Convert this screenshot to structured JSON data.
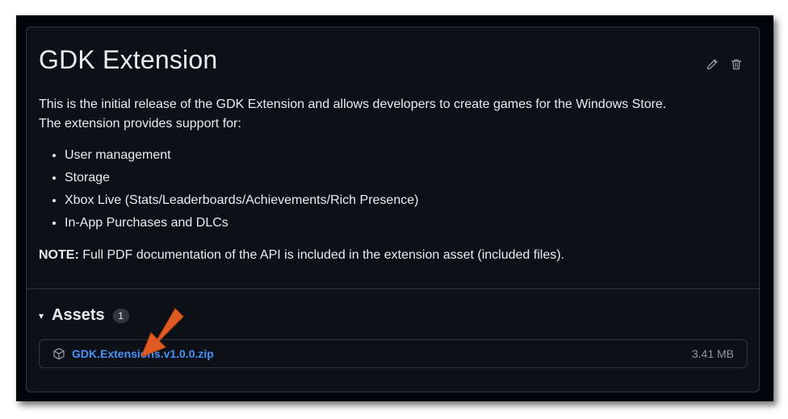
{
  "release": {
    "title": "GDK Extension",
    "description_line1": "This is the initial release of the GDK Extension and allows developers to create games for the Windows Store.",
    "description_line2": "The extension provides support for:",
    "features": [
      "User management",
      "Storage",
      "Xbox Live (Stats/Leaderboards/Achievements/Rich Presence)",
      "In-App Purchases and DLCs"
    ],
    "note_label": "NOTE:",
    "note_text": " Full PDF documentation of the API is included in the extension asset (included files).",
    "actions": {
      "edit_icon": "pencil-icon",
      "delete_icon": "trash-icon"
    }
  },
  "assets": {
    "caret": "▾",
    "label": "Assets",
    "count": "1",
    "items": [
      {
        "icon": "package-icon",
        "name": "GDK.Extensions.v1.0.0.zip",
        "size": "3.41 MB"
      }
    ]
  },
  "colors": {
    "background": "#0d1117",
    "border": "#30363d",
    "text": "#e6edf3",
    "link": "#4493f8",
    "muted": "#8d96a0",
    "annotation_arrow": "#e05a24"
  }
}
